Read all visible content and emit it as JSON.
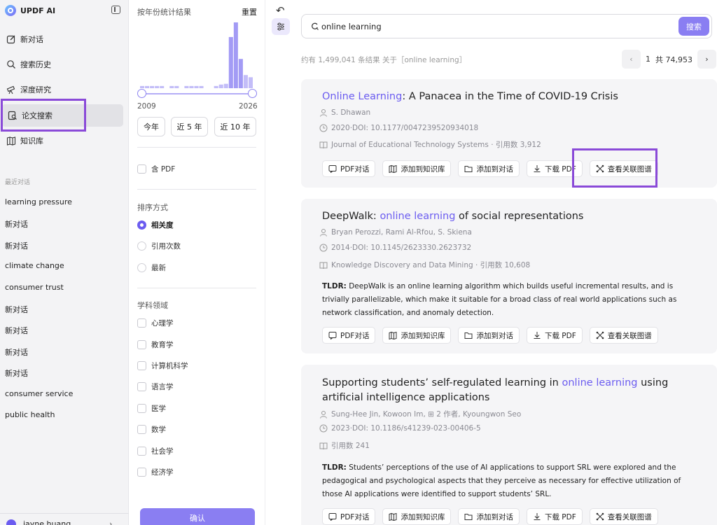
{
  "app": {
    "name": "UPDF AI"
  },
  "sidebar": {
    "items": [
      {
        "label": "新对话",
        "icon": "edit-icon"
      },
      {
        "label": "搜索历史",
        "icon": "search-icon"
      },
      {
        "label": "深度研究",
        "icon": "telescope-icon"
      },
      {
        "label": "论文搜索",
        "icon": "paper-search-icon",
        "active": true
      },
      {
        "label": "知识库",
        "icon": "library-icon"
      }
    ],
    "recent_title": "最近对话",
    "recent": [
      "learning pressure",
      "新对话",
      "新对话",
      "climate change",
      "consumer trust",
      "新对话",
      "新对话",
      "新对话",
      "新对话",
      "consumer service",
      "public health"
    ],
    "user": {
      "name": "jayne huang"
    }
  },
  "filter": {
    "title": "按年份统计结果",
    "reset": "重置",
    "histogram": [
      3,
      3,
      3,
      3,
      3,
      0,
      3,
      3,
      0,
      3,
      3,
      3,
      3,
      0,
      0,
      3,
      5,
      6,
      70,
      90,
      40,
      18,
      15
    ],
    "year_start": "2009",
    "year_end": "2026",
    "range_buttons": [
      "今年",
      "近 5 年",
      "近 10 年"
    ],
    "has_pdf": "含 PDF",
    "sort_title": "排序方式",
    "sort_options": [
      {
        "label": "相关度",
        "selected": true
      },
      {
        "label": "引用次数",
        "selected": false
      },
      {
        "label": "最新",
        "selected": false
      }
    ],
    "field_title": "学科领域",
    "fields": [
      "心理学",
      "教育学",
      "计算机科学",
      "语言学",
      "医学",
      "数学",
      "社会学",
      "经济学"
    ],
    "confirm": "确认"
  },
  "search": {
    "query": "online learning",
    "button": "搜索",
    "result_summary": "约有 1,499,041 条结果 关于［online learning］",
    "page": "1",
    "page_total": "共 74,953"
  },
  "actions": {
    "pdf_chat": "PDF对话",
    "add_kb": "添加到知识库",
    "add_chat": "添加到对话",
    "download": "下载 PDF",
    "graph": "查看关联图谱"
  },
  "papers": [
    {
      "title_pre": "",
      "title_hl": "Online Learning",
      "title_post": ": A Panacea in the Time of COVID-19 Crisis",
      "authors": "S. Dhawan",
      "year_doi": "2020·DOI: 10.1177/0047239520934018",
      "venue": "Journal of Educational Technology Systems · 引用数 3,912",
      "tldr_label": "",
      "tldr": ""
    },
    {
      "title_pre": "DeepWalk: ",
      "title_hl": "online learning",
      "title_post": " of social representations",
      "authors": "Bryan Perozzi,  Rami Al-Rfou,  S. Skiena",
      "year_doi": "2014·DOI: 10.1145/2623330.2623732",
      "venue": "Knowledge Discovery and Data Mining · 引用数 10,608",
      "tldr_label": "TLDR:",
      "tldr": " DeepWalk is an online learning algorithm which builds useful incremental results, and is trivially parallelizable, which make it suitable for a broad class of real world applications such as network classification, and anomaly detection."
    },
    {
      "title_pre": "Supporting students’  self-regulated learning in ",
      "title_hl": "online learning",
      "title_post": " using artificial intelligence applications",
      "authors": "Sung-Hee Jin,  Kowoon Im,  ⊞ 2 作者,  Kyoungwon Seo",
      "year_doi": "2023·DOI: 10.1186/s41239-023-00406-5",
      "venue": "引用数 241",
      "tldr_label": "TLDR:",
      "tldr": " Students’  perceptions of the use of AI applications to support SRL were explored and the pedagogical and psychological aspects that they perceive as necessary for effective utilization of those AI applications were identified to support students’  SRL."
    }
  ],
  "colors": {
    "accent": "#6b5cf0",
    "button": "#8a7ef2",
    "highlight_box": "#8a4ad8"
  }
}
